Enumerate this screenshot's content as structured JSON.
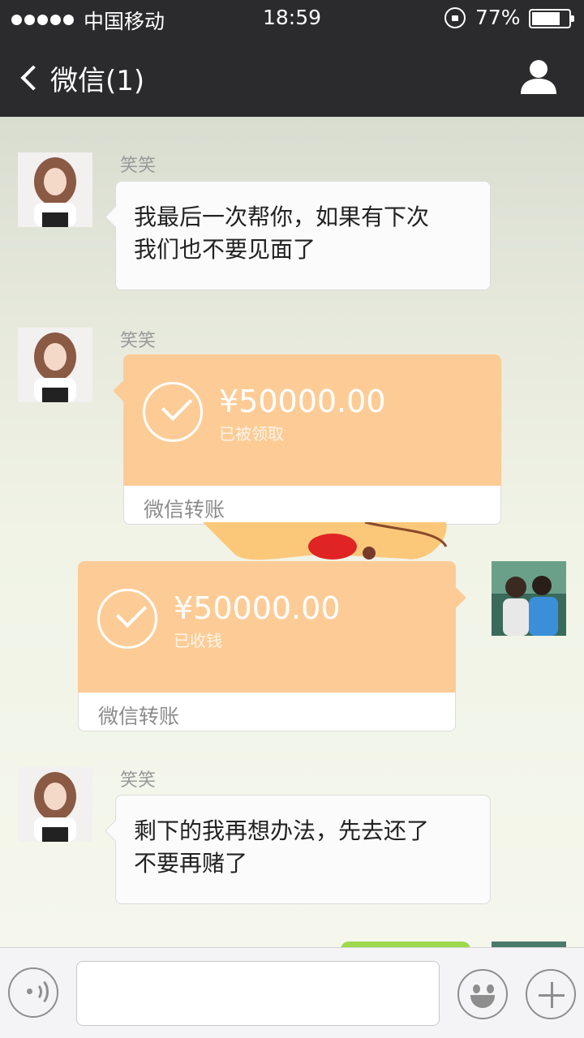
{
  "status_bar": {
    "carrier": "中国移动",
    "time": "18:59",
    "battery_percent": "77%"
  },
  "nav": {
    "back_label": "微信(1)",
    "profile_icon": "user-icon"
  },
  "messages": [
    {
      "type": "text",
      "side": "left",
      "sender": "笑笑",
      "lines": [
        "我最后一次帮你，如果有下次",
        "我们也不要见面了"
      ]
    },
    {
      "type": "transfer",
      "side": "left",
      "sender": "笑笑",
      "amount": "¥50000.00",
      "status": "已被领取",
      "footer": "微信转账"
    },
    {
      "type": "transfer",
      "side": "right",
      "amount": "¥50000.00",
      "status": "已收钱",
      "footer": "微信转账"
    },
    {
      "type": "text",
      "side": "left",
      "sender": "笑笑",
      "lines": [
        "剩下的我再想办法，先去还了",
        "不要再赌了"
      ]
    }
  ],
  "input_bar": {
    "voice_icon": "voice-icon",
    "emoji_icon": "emoji-icon",
    "plus_icon": "plus-icon",
    "placeholder": ""
  },
  "colors": {
    "nav_background": "#2b2b2d",
    "transfer_orange": "#fdcc96",
    "sent_green": "#9ed84d"
  }
}
